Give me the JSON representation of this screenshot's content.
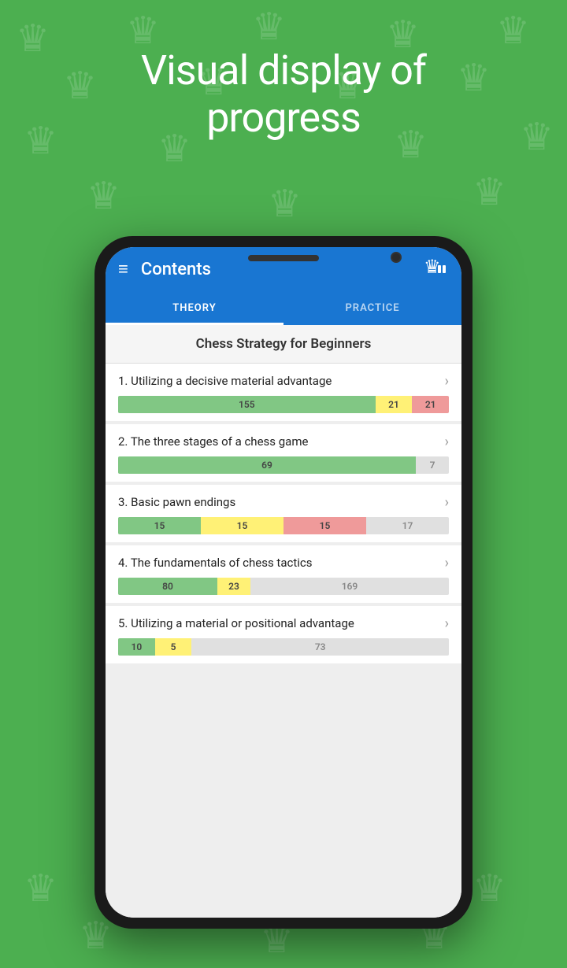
{
  "background": {
    "color": "#4caf50"
  },
  "hero": {
    "line1": "Visual display of",
    "line2": "progress"
  },
  "appBar": {
    "title": "Contents",
    "menuIcon": "≡",
    "logoIcon": "♛"
  },
  "tabs": [
    {
      "label": "THEORY",
      "active": true
    },
    {
      "label": "PRACTICE",
      "active": false
    }
  ],
  "courseTitle": "Chess Strategy for Beginners",
  "lessons": [
    {
      "number": "1",
      "title": "Utilizing a decisive material advantage",
      "bars": [
        {
          "type": "green",
          "value": 155,
          "flex": 7
        },
        {
          "type": "yellow",
          "value": 21,
          "flex": 1
        },
        {
          "type": "pink",
          "value": 21,
          "flex": 1
        }
      ]
    },
    {
      "number": "2",
      "title": "The three stages of a chess game",
      "bars": [
        {
          "type": "green",
          "value": 69,
          "flex": 9
        },
        {
          "type": "light",
          "value": 7,
          "flex": 1
        }
      ]
    },
    {
      "number": "3",
      "title": "Basic pawn endings",
      "bars": [
        {
          "type": "green",
          "value": 15,
          "flex": 3
        },
        {
          "type": "yellow",
          "value": 15,
          "flex": 3
        },
        {
          "type": "pink",
          "value": 15,
          "flex": 3
        },
        {
          "type": "light",
          "value": 17,
          "flex": 3
        }
      ]
    },
    {
      "number": "4",
      "title": "The fundamentals of chess tactics",
      "bars": [
        {
          "type": "green",
          "value": 80,
          "flex": 3
        },
        {
          "type": "yellow",
          "value": 23,
          "flex": 1
        },
        {
          "type": "light",
          "value": 169,
          "flex": 6
        }
      ]
    },
    {
      "number": "5",
      "title": "Utilizing a material or positional advantage",
      "bars": [
        {
          "type": "green",
          "value": 10,
          "flex": 1
        },
        {
          "type": "yellow",
          "value": 5,
          "flex": 1
        },
        {
          "type": "light",
          "value": 73,
          "flex": 7
        }
      ]
    }
  ]
}
